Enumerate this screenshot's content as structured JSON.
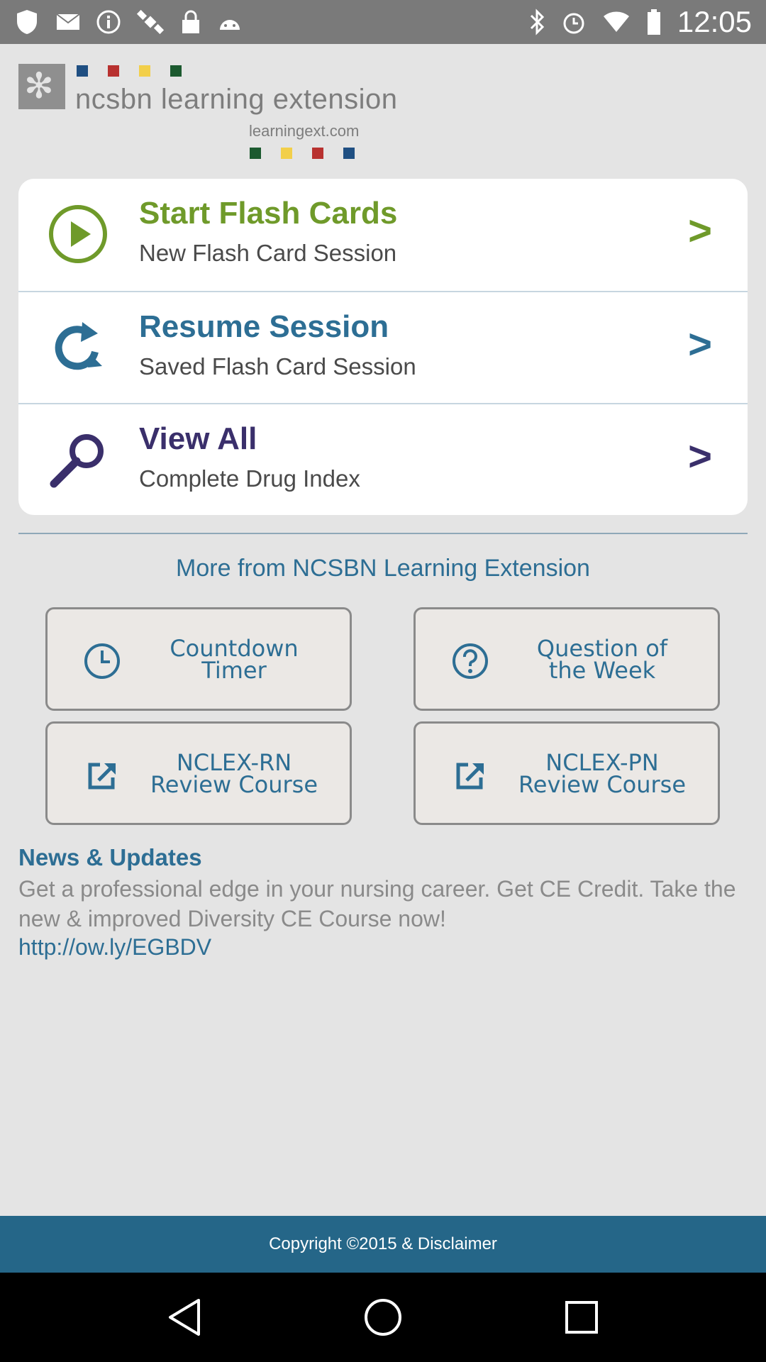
{
  "status_bar": {
    "time": "12:05",
    "left_icons": [
      "shield-icon",
      "mail-icon",
      "info-icon",
      "satellite-icon",
      "lock-icon",
      "android-icon"
    ],
    "right_icons": [
      "bluetooth-icon",
      "alarm-icon",
      "wifi-icon",
      "battery-icon"
    ]
  },
  "logo": {
    "name": "ncsbn learning extension",
    "url": "learningext.com",
    "dot_colors_top": [
      "#1f4f82",
      "#b8312f",
      "#f2cf4a",
      "#1c5a2f"
    ],
    "dot_colors_bottom": [
      "#1c5a2f",
      "#f2cf4a",
      "#b8312f",
      "#1f4f82"
    ]
  },
  "menu": {
    "items": [
      {
        "title": "Start Flash Cards",
        "subtitle": "New Flash Card Session",
        "icon": "play-icon",
        "color": "#6f9a2a",
        "chevron": ">"
      },
      {
        "title": "Resume Session",
        "subtitle": "Saved Flash Card Session",
        "icon": "refresh-icon",
        "color": "#2d6e94",
        "chevron": ">"
      },
      {
        "title": "View All",
        "subtitle": "Complete Drug Index",
        "icon": "search-icon",
        "color": "#3a2f6b",
        "chevron": ">"
      }
    ]
  },
  "more": {
    "heading": "More from NCSBN Learning Extension",
    "tiles": [
      {
        "label": "Countdown\nTimer",
        "icon": "clock-icon"
      },
      {
        "label": "Question of\nthe Week",
        "icon": "question-icon"
      },
      {
        "label": "NCLEX-RN\nReview Course",
        "icon": "external-link-icon"
      },
      {
        "label": "NCLEX-PN\nReview Course",
        "icon": "external-link-icon"
      }
    ]
  },
  "news": {
    "title": "News & Updates",
    "body": "Get a professional edge in your nursing career. Get CE Credit. Take the new & improved Diversity CE Course now!",
    "link": "http://ow.ly/EGBDV"
  },
  "footer": {
    "text": "Copyright ©2015 & Disclaimer"
  },
  "colors": {
    "accent": "#2d6e94",
    "footer": "#256688",
    "background": "#e4e4e4"
  }
}
